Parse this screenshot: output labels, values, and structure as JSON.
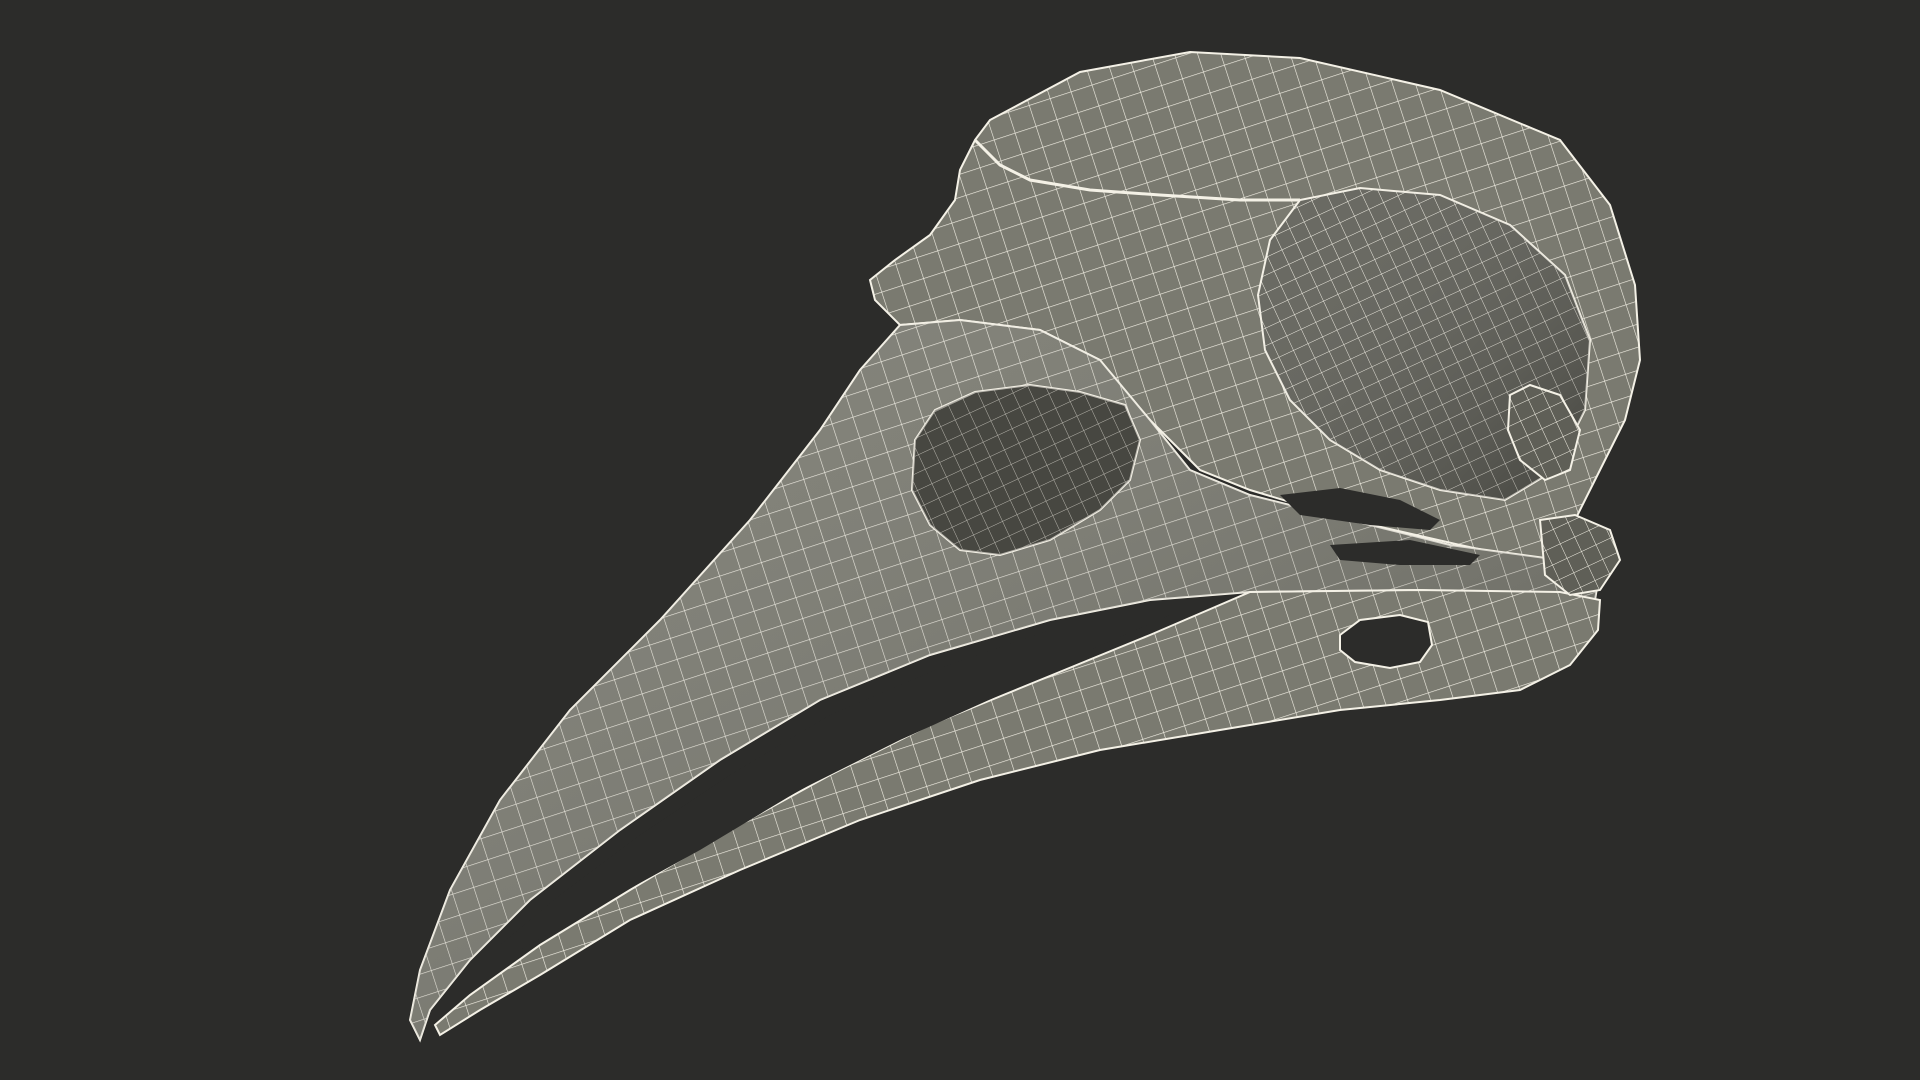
{
  "scene": {
    "subject": "bird-skull-wireframe",
    "background_color": "#2c2c2a",
    "mesh_fill_color": "#7a7a70",
    "mesh_fill_dark": "#5f5f57",
    "wire_color": "#f4f1e6",
    "opening_color": "#2c2c2a"
  }
}
